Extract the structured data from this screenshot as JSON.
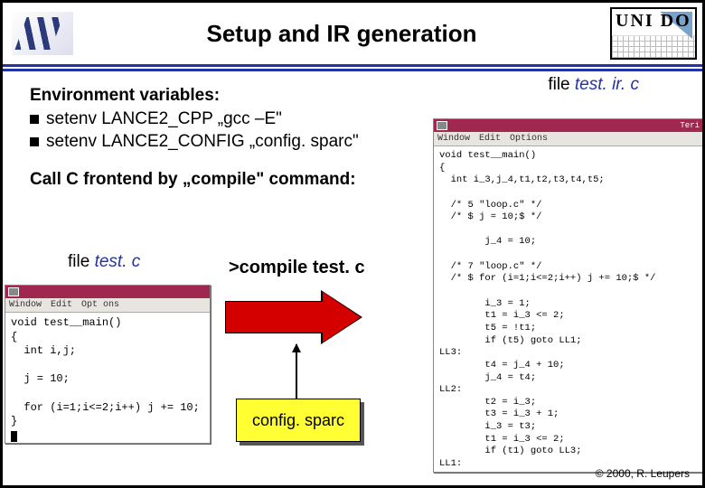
{
  "header": {
    "title": "Setup and IR generation",
    "logo_right_text": "UNI DO"
  },
  "env": {
    "heading": "Environment variables:",
    "items": [
      "setenv LANCE2_CPP „gcc –E\"",
      "setenv LANCE2_CONFIG „config. sparc\""
    ]
  },
  "call_line": "Call C frontend by „compile\" command:",
  "file_testc": {
    "prefix": "file ",
    "name": "test. c"
  },
  "file_ir": {
    "prefix": "file ",
    "name": "test. ir. c"
  },
  "compile_cmd": ">compile test. c",
  "config_box": "config. sparc",
  "term_left": {
    "menu": [
      "Window",
      "Edit",
      "Opt ons"
    ],
    "code": "void test__main()\n{\n  int i,j;\n\n  j = 10;\n\n  for (i=1;i<=2;i++) j += 10;\n}\n"
  },
  "term_right": {
    "title": "Teri",
    "menu": [
      "Window",
      "Edit",
      "Options"
    ],
    "code": "void test__main()\n{\n  int i_3,j_4,t1,t2,t3,t4,t5;\n\n  /* 5 \"loop.c\" */\n  /* $ j = 10;$ */\n\n        j_4 = 10;\n\n  /* 7 \"loop.c\" */\n  /* $ for (i=1;i<=2;i++) j += 10;$ */\n\n        i_3 = 1;\n        t1 = i_3 <= 2;\n        t5 = !t1;\n        if (t5) goto LL1;\nLL3:\n        t4 = j_4 + 10;\n        j_4 = t4;\nLL2:\n        t2 = i_3;\n        t3 = i_3 + 1;\n        i_3 = t3;\n        t1 = i_3 <= 2;\n        if (t1) goto LL3;\nLL1:"
  },
  "copyright": "© 2000, R. Leupers"
}
